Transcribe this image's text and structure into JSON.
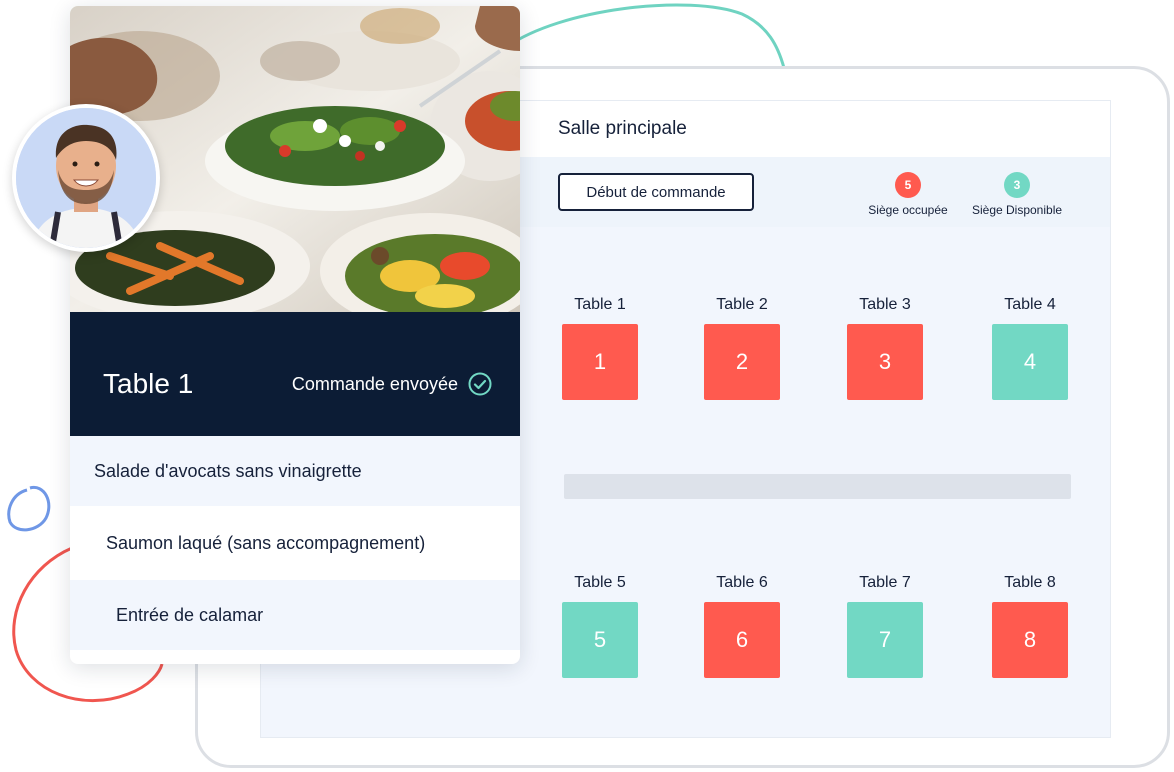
{
  "room": {
    "title": "Salle principale"
  },
  "toolbar": {
    "start_order_label": "Début de commande"
  },
  "legend": {
    "occupied": {
      "count": "5",
      "label": "Siège occupée",
      "color": "#ff5a4f"
    },
    "available": {
      "count": "3",
      "label": "Siège Disponible",
      "color": "#72d8c4"
    }
  },
  "tables": [
    {
      "label": "Table 1",
      "number": "1",
      "status": "occupied"
    },
    {
      "label": "Table 2",
      "number": "2",
      "status": "occupied"
    },
    {
      "label": "Table 3",
      "number": "3",
      "status": "occupied"
    },
    {
      "label": "Table 4",
      "number": "4",
      "status": "available"
    },
    {
      "label": "Table 5",
      "number": "5",
      "status": "available"
    },
    {
      "label": "Table 6",
      "number": "6",
      "status": "occupied"
    },
    {
      "label": "Table 7",
      "number": "7",
      "status": "available"
    },
    {
      "label": "Table 8",
      "number": "8",
      "status": "occupied"
    }
  ],
  "order_card": {
    "table_name": "Table 1",
    "status": "Commande envoyée",
    "status_icon": "check-circle-icon",
    "items": [
      "Salade d'avocats sans vinaigrette",
      "Saumon laqué (sans accompagnement)",
      "Entrée de calamar"
    ]
  },
  "colors": {
    "occupied": "#ff5a4f",
    "available": "#72d8c4",
    "navy": "#0c1c35",
    "deco_teal": "#6fd3c1",
    "deco_blue": "#6f97e6",
    "deco_red": "#f0564f"
  }
}
